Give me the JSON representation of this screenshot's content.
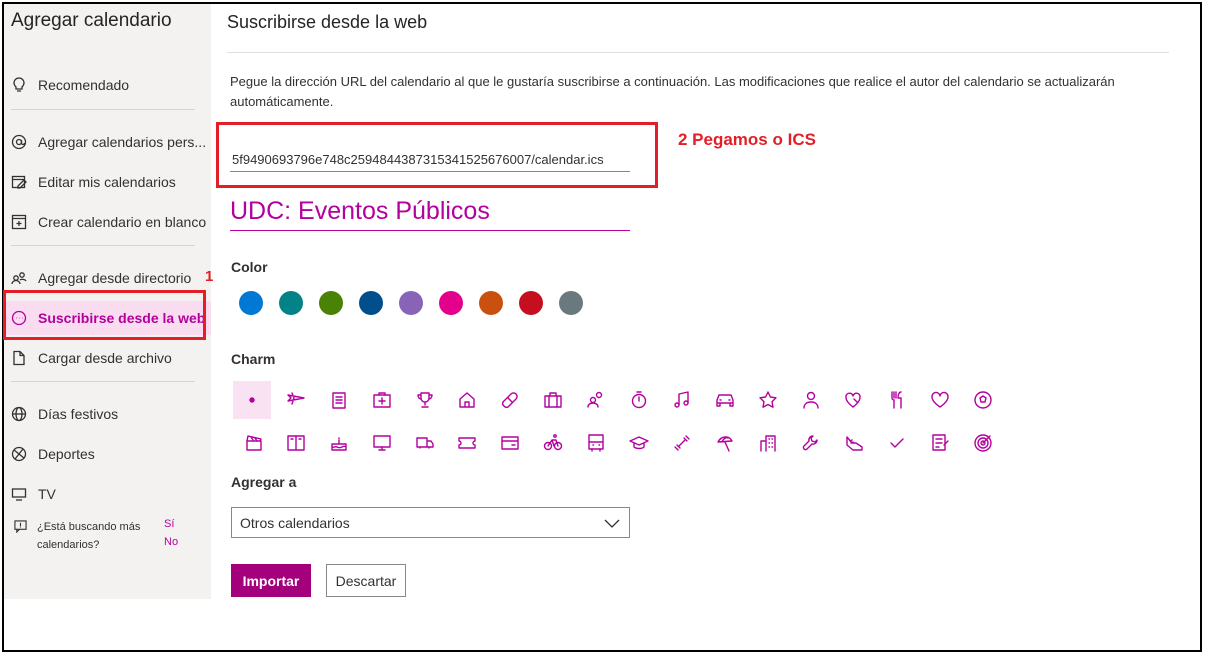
{
  "sidebar": {
    "title": "Agregar calendario",
    "items": [
      {
        "label": "Recomendado",
        "icon": "lightbulb-icon"
      },
      {
        "label": "Agregar calendarios pers...",
        "icon": "at-sign-icon"
      },
      {
        "label": "Editar mis calendarios",
        "icon": "edit-calendar-icon"
      },
      {
        "label": "Crear calendario en blanco",
        "icon": "add-calendar-icon"
      },
      {
        "label": "Agregar desde directorio",
        "icon": "people-icon"
      },
      {
        "label": "Suscribirse desde la web",
        "icon": "more-circle-icon"
      },
      {
        "label": "Cargar desde archivo",
        "icon": "file-icon"
      },
      {
        "label": "Días festivos",
        "icon": "globe-icon"
      },
      {
        "label": "Deportes",
        "icon": "ball-icon"
      },
      {
        "label": "TV",
        "icon": "tv-icon"
      }
    ],
    "help": {
      "question": "¿Está buscando más calendarios?",
      "yes": "Sí",
      "no": "No"
    }
  },
  "annotations": {
    "one": "1",
    "two": "2 Pegamos o ICS"
  },
  "main": {
    "title": "Suscribirse desde la web",
    "description": "Pegue la dirección URL del calendario al que le gustaría suscribirse a continuación. Las modificaciones que realice el autor del calendario se actualizarán automáticamente.",
    "url_value": "5f9490693796e748c25948443873153415256760 07/calendar.ics",
    "calendar_name": "UDC: Eventos Públicos",
    "color_label": "Color",
    "colors": [
      "#0078d4",
      "#038387",
      "#498205",
      "#004e8c",
      "#8764b8",
      "#e3008c",
      "#ca5010",
      "#c50f1f",
      "#69797e"
    ],
    "charm_label": "Charm",
    "add_to_label": "Agregar a",
    "add_to_value": "Otros calendarios",
    "import_button": "Importar",
    "discard_button": "Descartar"
  }
}
